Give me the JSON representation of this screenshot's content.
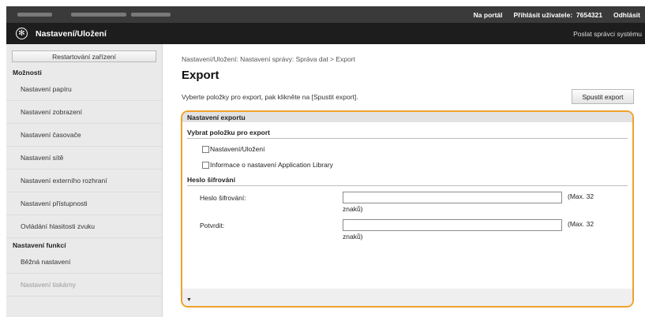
{
  "topbar": {
    "portal_label": "Na portál",
    "login_label": "Přihlásit uživatele:",
    "user_id": "7654321",
    "logout_label": "Odhlásit"
  },
  "header": {
    "title": "Nastavení/Uložení",
    "send_label": "Poslat správci systému"
  },
  "sidebar": {
    "restart_label": "Restartování zařízení",
    "options_head": "Možnosti",
    "items": [
      {
        "label": "Nastavení papíru"
      },
      {
        "label": "Nastavení zobrazení"
      },
      {
        "label": "Nastavení časovače"
      },
      {
        "label": "Nastavení sítě"
      },
      {
        "label": "Nastavení externího rozhraní"
      },
      {
        "label": "Nastavení přístupnosti"
      },
      {
        "label": "Ovládání hlasitosti zvuku"
      }
    ],
    "functions_head": "Nastavení funkcí",
    "func_items": [
      {
        "label": "Běžná nastavení"
      },
      {
        "label": "Nastavení tiskárny"
      }
    ]
  },
  "main": {
    "breadcrumb": "Nastavení/Uložení: Nastavení správy: Správa dat > Export",
    "title": "Export",
    "description": "Vyberte položky pro export, pak klikněte na [Spustit export].",
    "start_button": "Spustit export",
    "panel": {
      "head": "Nastavení exportu",
      "select_head": "Vybrat položku pro export",
      "checkboxes": [
        {
          "label": "Nastavení/Uložení"
        },
        {
          "label": "Informace o nastavení Application Library"
        }
      ],
      "password_head": "Heslo šifrování",
      "fields": [
        {
          "label": "Heslo šifrování:",
          "hint1": "(Max. 32",
          "hint2": "znaků)"
        },
        {
          "label": "Potvrdit:",
          "hint1": "(Max. 32",
          "hint2": "znaků)"
        }
      ],
      "foot_icon": "▼"
    }
  }
}
